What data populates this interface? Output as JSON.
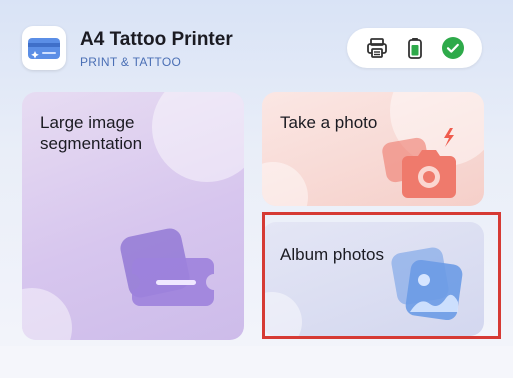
{
  "header": {
    "app_title": "A4 Tattoo Printer",
    "app_subtitle": "PRINT & TATTOO",
    "status_icons": [
      "printer-icon",
      "battery-icon",
      "connected-check-icon"
    ]
  },
  "cards": {
    "large_segmentation": {
      "label_line1": "Large image",
      "label_line2": "segmentation",
      "icon": "segmentation-icon"
    },
    "take_photo": {
      "label": "Take a photo",
      "icon": "camera-icon"
    },
    "album_photos": {
      "label": "Album photos",
      "icon": "album-icon"
    }
  },
  "colors": {
    "accent_blue": "#4a6fb5",
    "status_green": "#2eaa4a",
    "highlight_red": "#d63a34",
    "segmentation_purple": "#8a6fd1",
    "camera_coral": "#ef7a6c",
    "album_blue": "#6b9be6"
  }
}
